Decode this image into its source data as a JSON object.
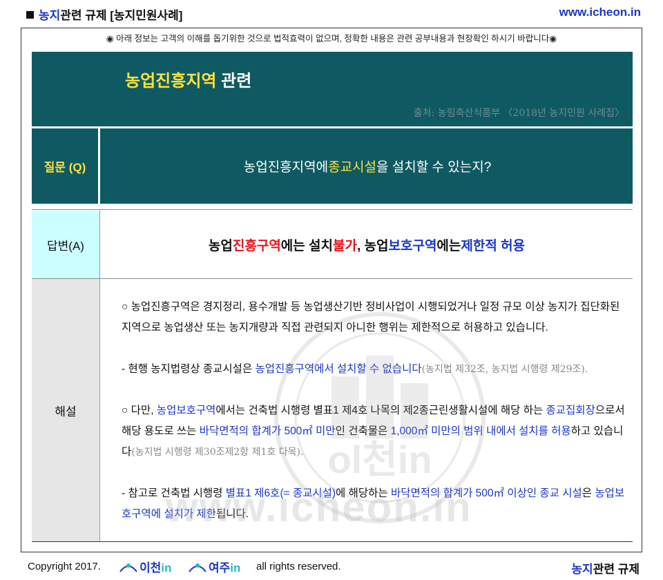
{
  "top": {
    "title_blue": "농지",
    "title_rest": "관련 규제 [농지민원사례]",
    "url": "www.icheon.in"
  },
  "notice": "◉ 아래 정보는 고객의 이해를 돕기위한 것으로 법적효력이 없으며, 정확한 내용은 관련 공부내용과 현장확인 하시기 바랍니다◉",
  "header": {
    "title_highlight": "농업진흥지역",
    "title_rest": " 관련",
    "source": "출처: 농림축산식품부 〈2018년 농지민원 사례집〉"
  },
  "question": {
    "label": "질문 (Q)",
    "text_1": "농업진흥지역에 ",
    "text_highlight": "종교시설",
    "text_2": "을 설치할 수 있는지?"
  },
  "answer": {
    "label": "답변(A)",
    "p1": "농업",
    "p2": "진흥구역",
    "p3": "에는 설치",
    "p4": "불가",
    "p5": ", 농업",
    "p6": "보호구역",
    "p7": "에는 ",
    "p8": "제한적 허용"
  },
  "explanation": {
    "label": "해설",
    "para1": "○ 농업진흥구역은 경지정리, 용수개발 등 농업생산기반 정비사업이 시행되었거나 일정 규모 이상 농지가 집단화된 지역으로 농업생산 또는 농지개량과 직접 관련되지 아니한 행위는 제한적으로 허용하고 있습니다.",
    "para2_a": "- 현행 농지법령상 종교시설은 ",
    "para2_b": "농업진흥구역에서 설치할 수 없습니다",
    "para2_c": "(농지법 제32조, 농지법 시행령 제29조).",
    "para3_a": "○ 다만, ",
    "para3_b": "농업보호구역",
    "para3_c": "에서는  건축법 시행령  별표1 제4호 나목의 제2종근린생활시설에 해당 하는 ",
    "para3_d": "종교집회장",
    "para3_e": "으로서 해당 용도로 쓰는 ",
    "para3_f": "바닥면적의 합계가 500㎡ 미만",
    "para3_g": "인 건축물은 ",
    "para3_h": "1,000㎡ 미만의 범위 내에서 설치를 허용",
    "para3_i": "하고 있습니다",
    "para3_j": "(농지법 시행령 제30조제2항 제1호 다목).",
    "para4_a": "- 참고로  건축법 시행령  ",
    "para4_b": "별표1 제6호(= 종교시설)",
    "para4_c": "에 해당하는 ",
    "para4_d": "바닥면적의 합계가 500㎡ 이상인 종교 시설",
    "para4_e": "은 ",
    "para4_f": "농업보호구역에 설치가 제한",
    "para4_g": "됩니다."
  },
  "watermark": "www.icheon.in",
  "footer": {
    "copyright": "Copyright 2017.",
    "logo1_a": "이천",
    "logo1_b": "in",
    "logo2_a": "여주",
    "logo2_b": "in",
    "rights": "all rights reserved.",
    "right_blue": "농지",
    "right_rest": "관련 규제"
  },
  "colors": {
    "header_bg": "#0f5a62",
    "highlight_yellow": "#ffe23a",
    "accent_blue": "#1a35c8",
    "accent_red": "#e8101a",
    "answer_label_bg": "#ccffff",
    "explain_label_bg": "#e6e6e6"
  }
}
